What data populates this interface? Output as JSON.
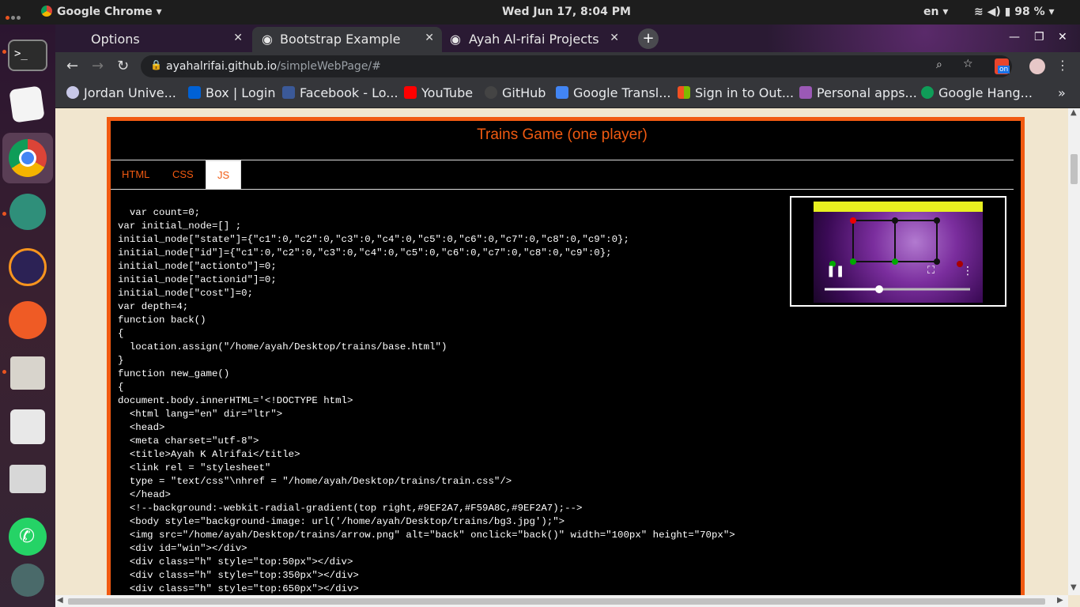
{
  "system": {
    "app_name": "Google Chrome",
    "clock": "Wed Jun 17,  8:04 PM",
    "language": "en",
    "battery": "98 %"
  },
  "browser": {
    "tabs": [
      {
        "label": "Options"
      },
      {
        "label": "Bootstrap Example"
      },
      {
        "label": "Ayah Al-rifai Projects"
      }
    ],
    "url_domain": "ayahalrifai.github.io",
    "url_path": "/simpleWebPage/#",
    "bookmarks": [
      "Jordan Unive...",
      "Box | Login",
      "Facebook - Lo...",
      "YouTube",
      "GitHub",
      "Google Transl...",
      "Sign in to Out...",
      "Personal apps...",
      "Google Hang..."
    ],
    "extension_badge": "on"
  },
  "page": {
    "title": "Trains Game (one player)",
    "tabs": [
      "HTML",
      "CSS",
      "JS"
    ],
    "active_tab": "JS",
    "code": "  var count=0;\nvar initial_node=[] ;\ninitial_node[\"state\"]={\"c1\":0,\"c2\":0,\"c3\":0,\"c4\":0,\"c5\":0,\"c6\":0,\"c7\":0,\"c8\":0,\"c9\":0};\ninitial_node[\"id\"]={\"c1\":0,\"c2\":0,\"c3\":0,\"c4\":0,\"c5\":0,\"c6\":0,\"c7\":0,\"c8\":0,\"c9\":0};\ninitial_node[\"actionto\"]=0;\ninitial_node[\"actionid\"]=0;\ninitial_node[\"cost\"]=0;\nvar depth=4;\nfunction back()\n{\n  location.assign(\"/home/ayah/Desktop/trains/base.html\")\n}\nfunction new_game()\n{\ndocument.body.innerHTML='<!DOCTYPE html>\n  <html lang=\"en\" dir=\"ltr\">\n  <head>\n  <meta charset=\"utf-8\">\n  <title>Ayah K Alrifai</title>\n  <link rel = \"stylesheet\"\n  type = \"text/css\"\\nhref = \"/home/ayah/Desktop/trains/train.css\"/>\n  </head>\n  <!--background:-webkit-radial-gradient(top right,#9EF2A7,#F59A8C,#9EF2A7);-->\n  <body style=\"background-image: url('/home/ayah/Desktop/trains/bg3.jpg');\">\n  <img src=\"/home/ayah/Desktop/trains/arrow.png\" alt=\"back\" onclick=\"back()\" width=\"100px\" height=\"70px\">\n  <div id=\"win\"></div>\n  <div class=\"h\" style=\"top:50px\"></div>\n  <div class=\"h\" style=\"top:350px\"></div>\n  <div class=\"h\" style=\"top:650px\"></div>"
  },
  "colors": {
    "accent": "#f15a11",
    "page_bg": "#f1e6cf",
    "code_bg": "#000000"
  }
}
